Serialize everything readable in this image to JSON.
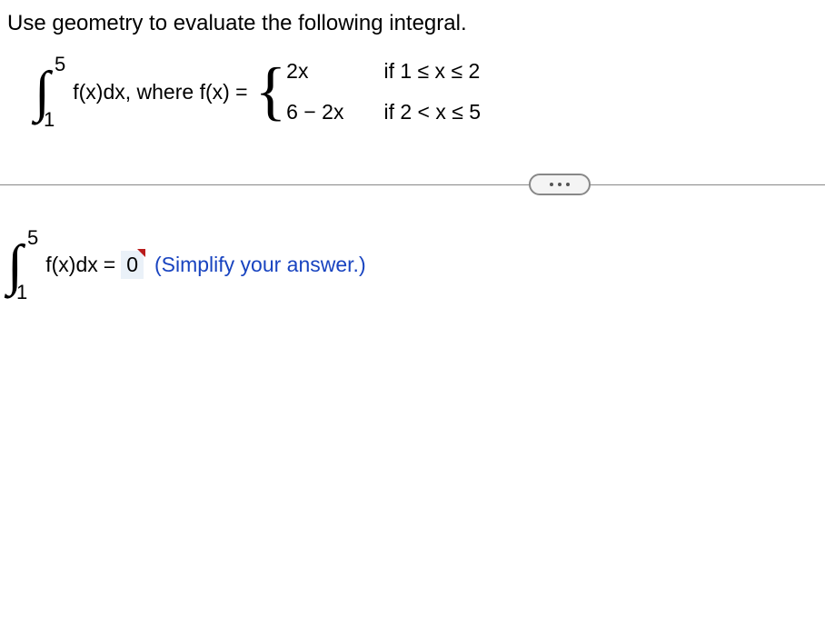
{
  "prompt": "Use geometry to evaluate the following integral.",
  "integral": {
    "upper": "5",
    "lower": "1",
    "integrand": "f(x)dx,",
    "where": " where f(x) ="
  },
  "piecewise": {
    "row1": {
      "expr": "2x",
      "cond": "if 1 ≤ x ≤ 2"
    },
    "row2": {
      "expr": "6 − 2x",
      "cond": "if 2 < x ≤ 5"
    }
  },
  "answer": {
    "upper": "5",
    "lower": "1",
    "lhs": "f(x)dx",
    "equals": " = ",
    "value": "0",
    "hint": "(Simplify your answer.)"
  }
}
